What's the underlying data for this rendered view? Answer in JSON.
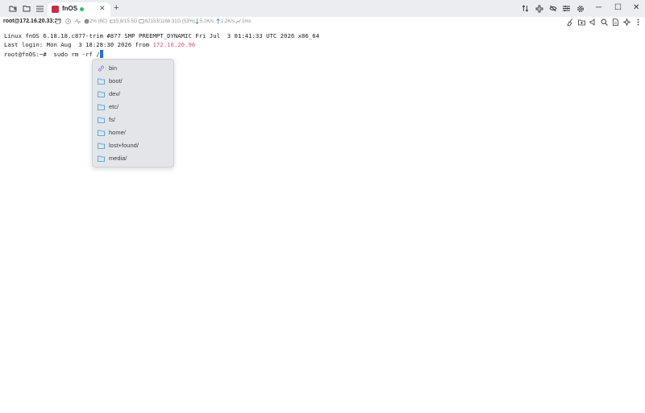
{
  "tab": {
    "title": "fnOS"
  },
  "session": {
    "host": "root@172.16.20.33:22",
    "cpu": "2% (6C)",
    "memory": "5.8/15.5G",
    "disk": "62153/1168.31G (53%)",
    "download": "5.2K/s",
    "upload": "1.2K/s",
    "latency": "1ms"
  },
  "terminal": {
    "line1": "Linux fnOS 6.18.18.c877-trim #877 SMP PREEMPT_DYNAMIC Fri Jul  3 01:41:33 UTC 2026 x86_64",
    "line2_prefix": "Last login: Mon Aug  3 18:28:30 2026 from ",
    "line2_ip": "172.16.20.96",
    "prompt": "root@fnOS:~# ",
    "command": " sudo rm -rf /"
  },
  "completion": {
    "items": [
      {
        "label": "bin",
        "icon": "link-icon"
      },
      {
        "label": "boot/",
        "icon": "folder-icon"
      },
      {
        "label": "dev/",
        "icon": "folder-icon"
      },
      {
        "label": "etc/",
        "icon": "folder-icon"
      },
      {
        "label": "fs/",
        "icon": "folder-icon"
      },
      {
        "label": "home/",
        "icon": "folder-icon"
      },
      {
        "label": "lost+found/",
        "icon": "folder-icon"
      },
      {
        "label": "media/",
        "icon": "folder-icon"
      }
    ]
  },
  "colors": {
    "accent": "#1f6fe5",
    "ip_highlight": "#e05578",
    "status_online": "#2fbf71",
    "brand": "#c72c48"
  }
}
